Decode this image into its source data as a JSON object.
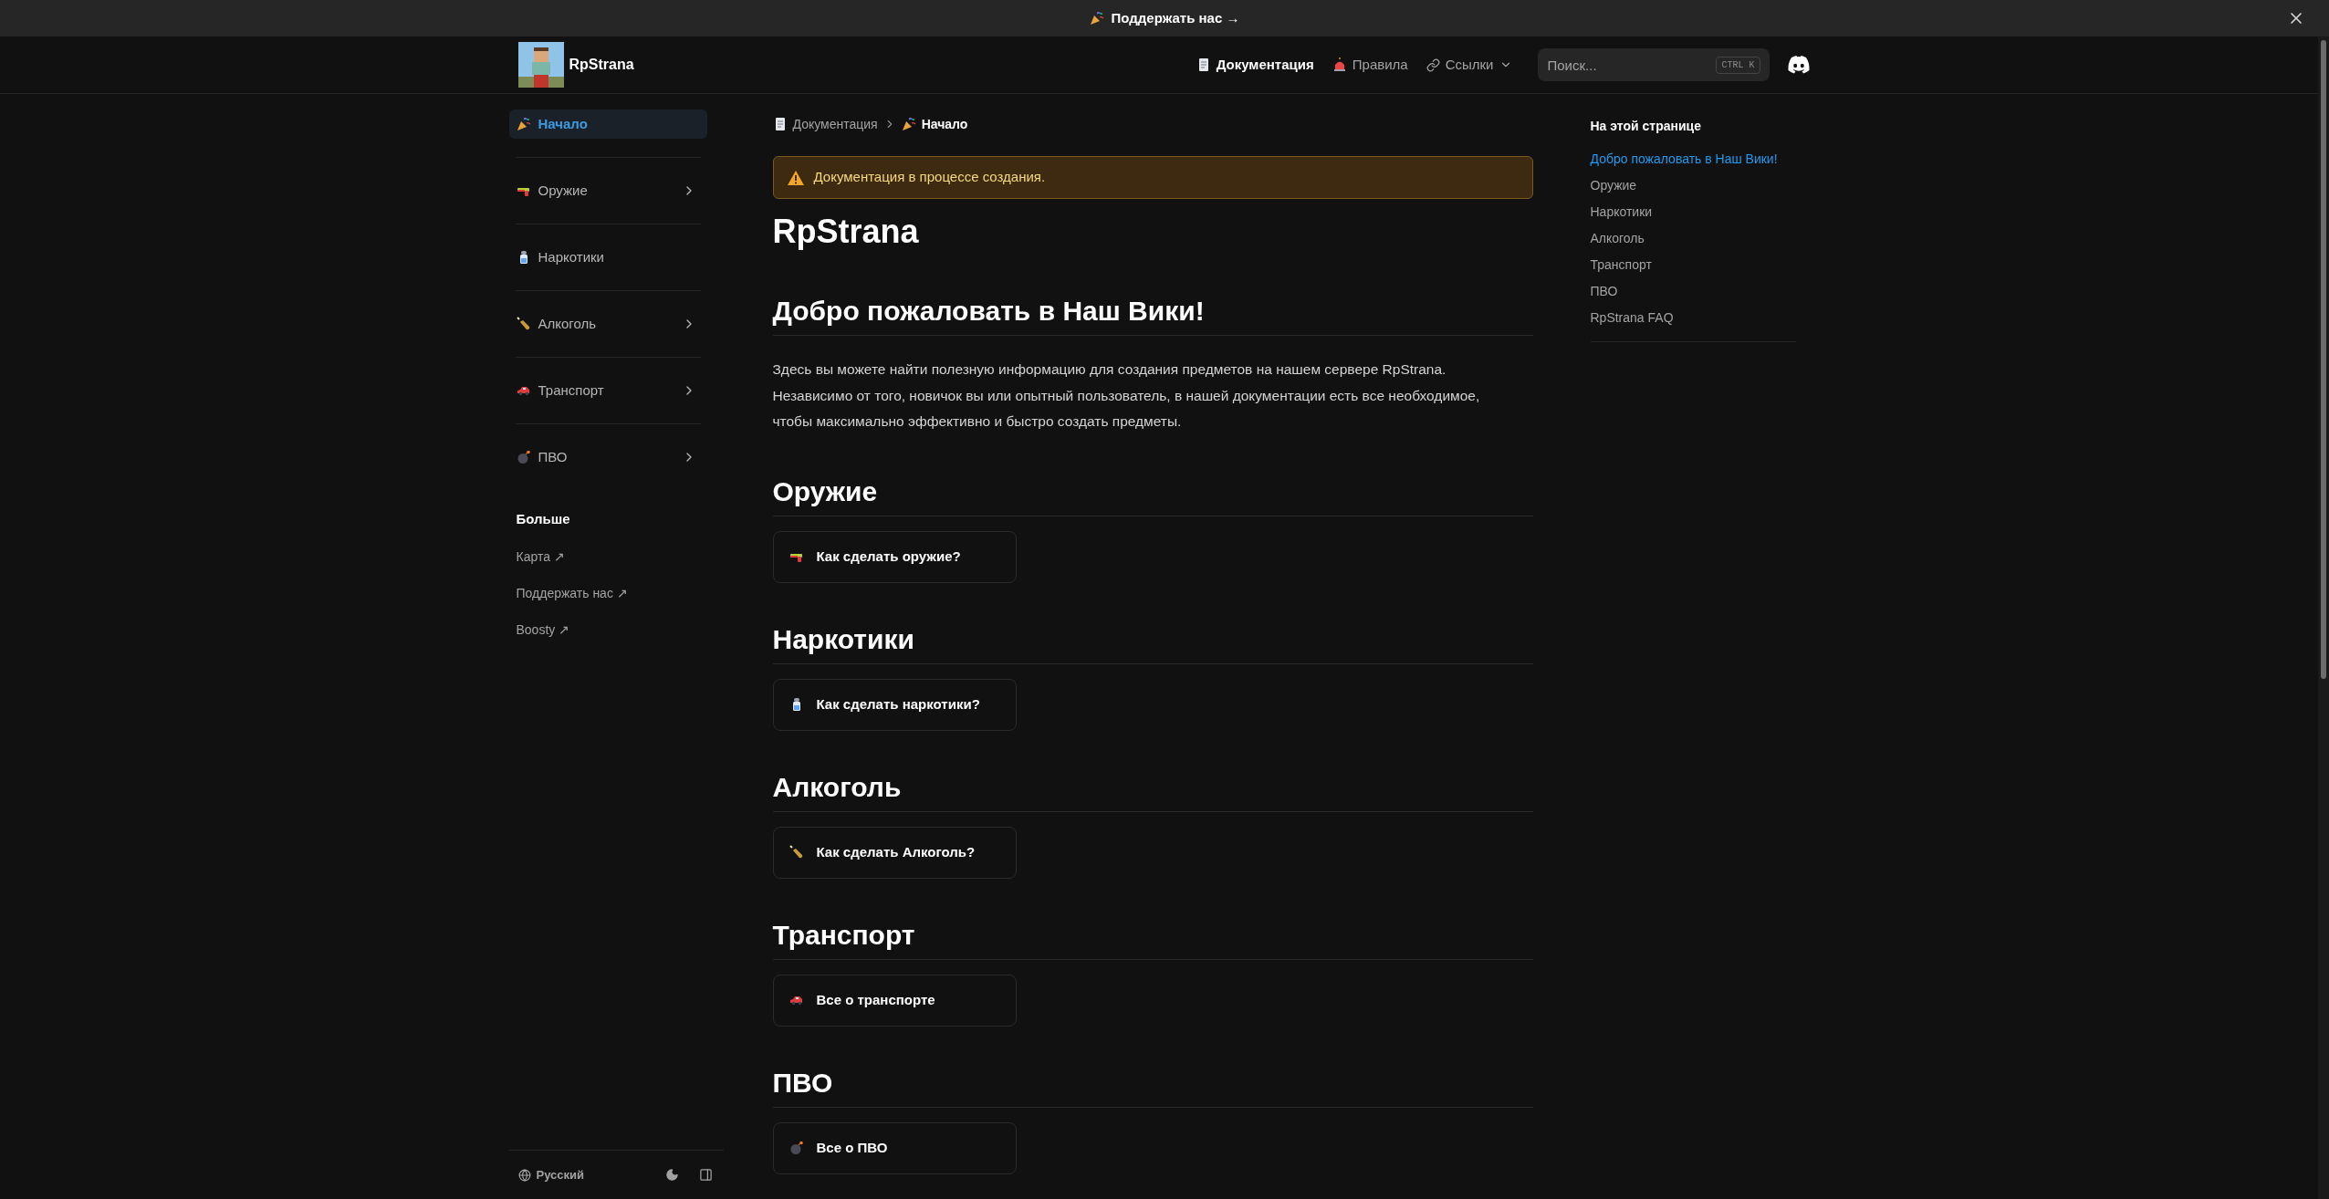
{
  "banner": {
    "text": "Поддержать нас →"
  },
  "header": {
    "logo_text": "RpStrana",
    "nav": [
      {
        "label": "Документация",
        "selected": true,
        "kind": "page"
      },
      {
        "label": "Правила",
        "selected": false,
        "kind": "page"
      },
      {
        "label": "Ссылки",
        "selected": false,
        "kind": "dropdown"
      }
    ],
    "search": {
      "placeholder": "Поиск...",
      "shortcut": "CTRL K"
    }
  },
  "sidebar": {
    "items": [
      {
        "label": "Начало",
        "selected": true,
        "expandable": false
      },
      {
        "label": "Оружие",
        "selected": false,
        "expandable": true
      },
      {
        "label": "Наркотики",
        "selected": false,
        "expandable": false
      },
      {
        "label": "Алкоголь",
        "selected": false,
        "expandable": true
      },
      {
        "label": "Транспорт",
        "selected": false,
        "expandable": true
      },
      {
        "label": "ПВО",
        "selected": false,
        "expandable": true
      }
    ],
    "more_title": "Больше",
    "links": [
      {
        "label": "Карта ↗"
      },
      {
        "label": "Поддержать нас ↗"
      },
      {
        "label": "Boosty ↗"
      }
    ],
    "language": "Русский"
  },
  "breadcrumb": [
    "Документация",
    "Начало"
  ],
  "callout": {
    "text": "Документация в процессе создания."
  },
  "title": "RpStrana",
  "intro": {
    "heading": "Добро пожаловать в Наш Вики!",
    "paragraph": "Здесь вы можете найти полезную информацию для создания предметов на нашем сервере RpStrana. Независимо от того, новичок вы или опытный пользователь, в нашей документации есть все необходимое, чтобы максимально эффективно и быстро создать предметы."
  },
  "sections": [
    {
      "heading": "Оружие",
      "card": "Как сделать оружие?"
    },
    {
      "heading": "Наркотики",
      "card": "Как сделать наркотики?"
    },
    {
      "heading": "Алкоголь",
      "card": "Как сделать Алкоголь?"
    },
    {
      "heading": "Транспорт",
      "card": "Все о транспорте"
    },
    {
      "heading": "ПВО",
      "card": "Все о ПВО"
    }
  ],
  "toc": {
    "title": "На этой странице",
    "items": [
      {
        "label": "Добро пожаловать в Наш Вики!",
        "selected": true
      },
      {
        "label": "Оружие",
        "selected": false
      },
      {
        "label": "Наркотики",
        "selected": false
      },
      {
        "label": "Алкоголь",
        "selected": false
      },
      {
        "label": "Транспорт",
        "selected": false
      },
      {
        "label": "ПВО",
        "selected": false
      },
      {
        "label": "RpStrana FAQ",
        "selected": false
      }
    ]
  }
}
